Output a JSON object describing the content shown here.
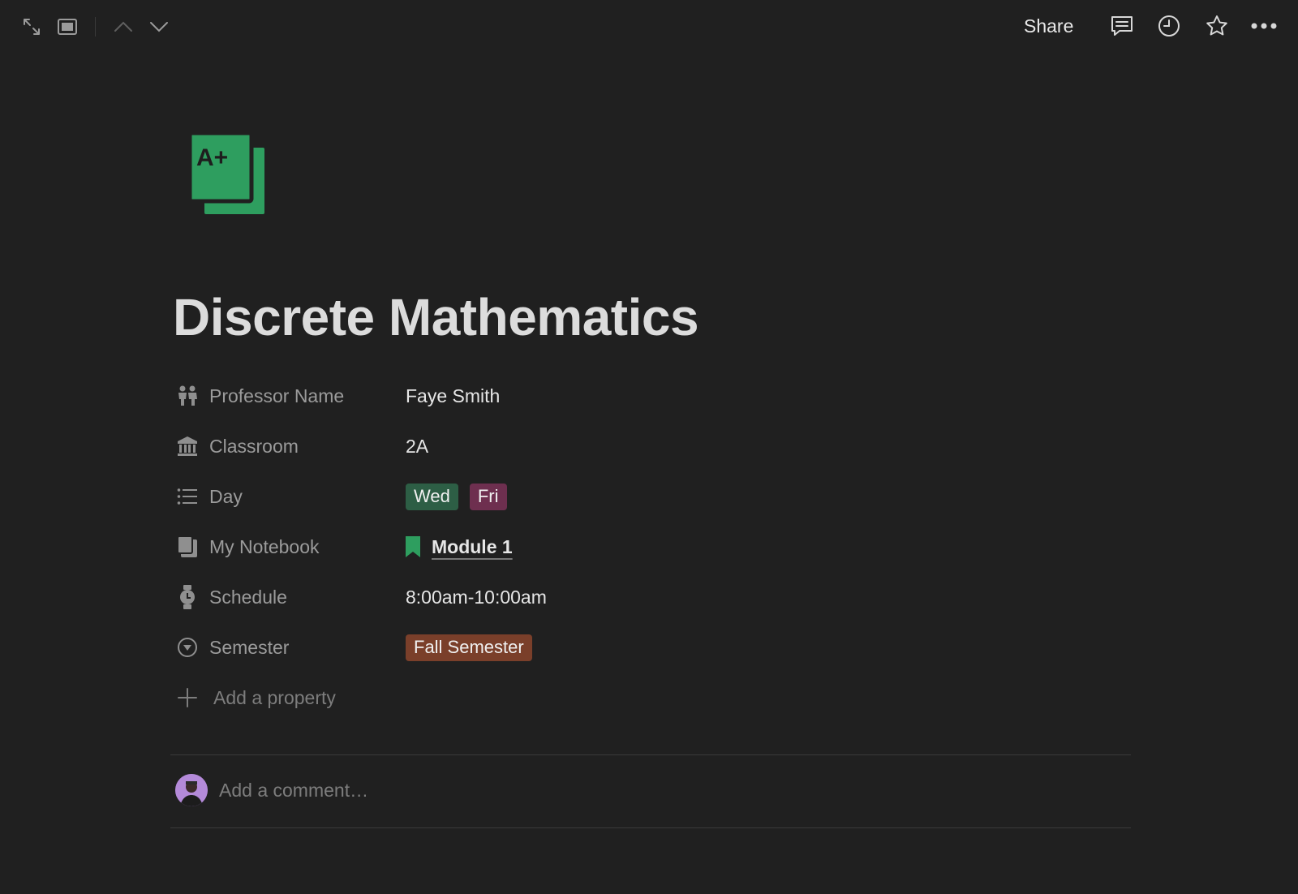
{
  "topbar": {
    "share_label": "Share",
    "icons": [
      "expand-icon",
      "peek-mode-icon",
      "chevron-up-icon",
      "chevron-down-icon",
      "comment-icon",
      "history-icon",
      "star-icon",
      "more-icon"
    ]
  },
  "page": {
    "icon": "a-plus-notebook-icon",
    "title": "Discrete Mathematics"
  },
  "properties": [
    {
      "key": "Professor Name",
      "icon": "people-icon",
      "value": "Faye Smith"
    },
    {
      "key": "Classroom",
      "icon": "building-icon",
      "value": "2A"
    },
    {
      "key": "Day",
      "icon": "list-icon",
      "tags": [
        {
          "label": "Wed",
          "color": "#2d5e45"
        },
        {
          "label": "Fri",
          "color": "#6e2f4f"
        }
      ]
    },
    {
      "key": "My Notebook",
      "icon": "notebook-icon",
      "link": {
        "icon": "bookmark-icon",
        "label": "Module 1"
      }
    },
    {
      "key": "Schedule",
      "icon": "watch-icon",
      "value": "8:00am-10:00am"
    },
    {
      "key": "Semester",
      "icon": "select-icon",
      "tags": [
        {
          "label": "Fall Semester",
          "color": "#7a3f2a"
        }
      ]
    }
  ],
  "add_property_label": "Add a property",
  "comment": {
    "placeholder": "Add a comment…"
  },
  "colors": {
    "background": "#202020",
    "icon_green": "#2e9e5f"
  }
}
